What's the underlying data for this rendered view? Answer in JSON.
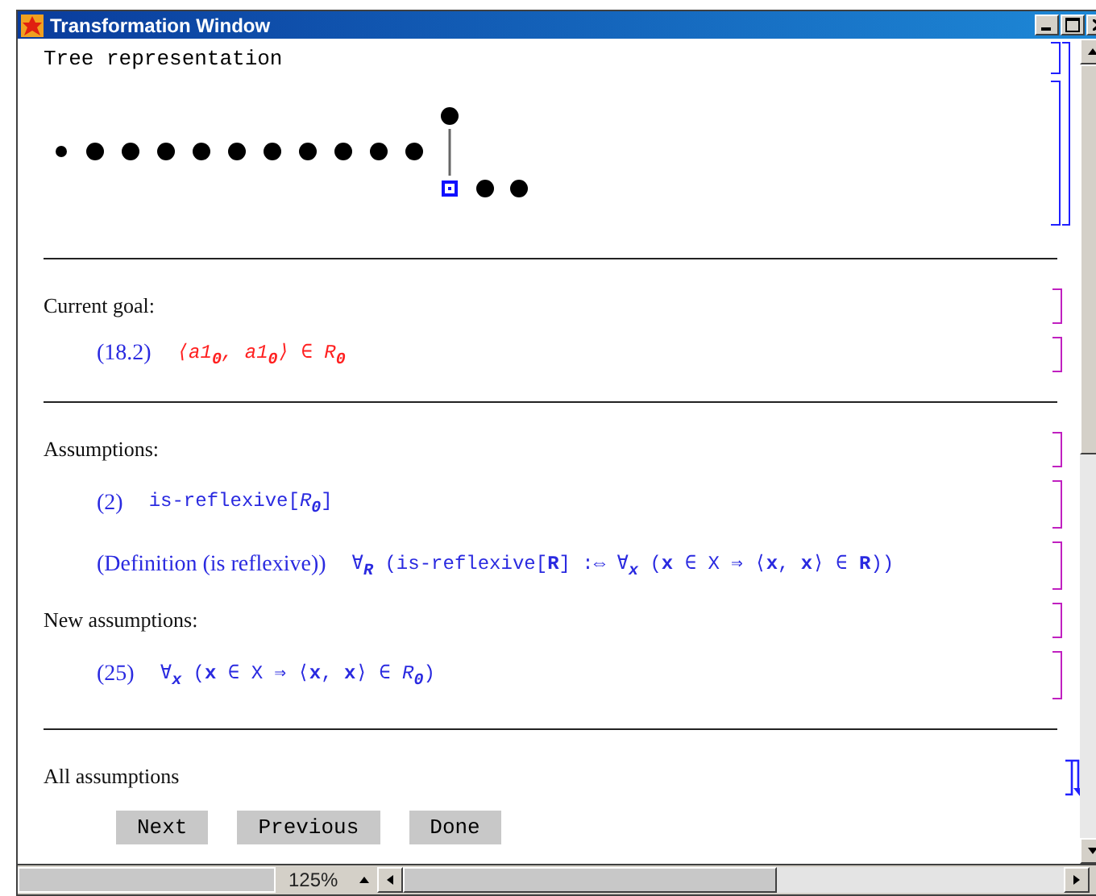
{
  "window": {
    "title": "Transformation Window"
  },
  "groups": [
    {
      "collapsed": false,
      "color": "#2020ff",
      "cells": [
        {
          "kind": "title",
          "text": "Tree representation",
          "color": "#2020ff"
        },
        {
          "kind": "tree",
          "color": "#2020ff"
        }
      ]
    },
    {
      "cells": [
        {
          "kind": "heading",
          "text": "Current goal:",
          "color": "#c020c0"
        },
        {
          "kind": "goal",
          "label": "(18.2)",
          "formula": "⟨a1$_{0}$, a1$_{0}$⟩ ∈ R$_{0}$",
          "color": "#c020c0"
        }
      ]
    },
    {
      "cells": [
        {
          "kind": "heading",
          "text": "Assumptions:",
          "color": "#c020c0"
        },
        {
          "kind": "assumption",
          "label": "(2)",
          "formula": "is-reflexive[*R*$_{0}$]",
          "color": "#c020c0"
        },
        {
          "kind": "assumption",
          "label": "(Definition (is reflexive))",
          "formula": "∀$_{R}$ (is-reflexive[**R**] :⇔ ∀$_{x}$ (**x** ∈ X ⇒ ⟨**x**, **x**⟩ ∈ **R**))",
          "color": "#c020c0"
        },
        {
          "kind": "heading",
          "text": "New assumptions:",
          "color": "#c020c0"
        },
        {
          "kind": "assumption",
          "label": "(25)",
          "formula": "∀$_{x}$ (**x** ∈ X ⇒ ⟨**x**, **x**⟩ ∈ *R*$_{0}$)",
          "color": "#c020c0"
        }
      ]
    },
    {
      "collapsed": true,
      "color": "#2020ff",
      "cells": [
        {
          "kind": "heading",
          "text": "All assumptions"
        },
        {
          "kind": "buttons",
          "buttons": [
            "Next",
            "Previous",
            "Done"
          ]
        }
      ]
    }
  ],
  "status_bar": {
    "zoom": "125%"
  }
}
